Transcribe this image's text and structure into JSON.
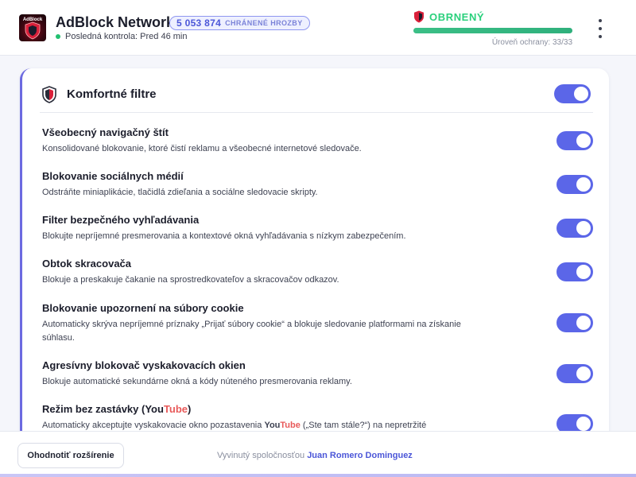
{
  "header": {
    "app_title": "AdBlock Network",
    "logo_text": "AdBlock",
    "threats_count": "5 053 874",
    "threats_label": "CHRÁNENÉ HROZBY",
    "last_check": "Posledná kontrola: Pred 46 min",
    "status": "OBRNENÝ",
    "protection_level_text": "Úroveň ochrany: 33/33",
    "protection_level_fraction": 1.0,
    "menu_icon": "kebab-menu-icon"
  },
  "card": {
    "title": "Komfortné filtre",
    "enabled": true,
    "items": [
      {
        "title": "Všeobecný navigačný štít",
        "desc": "Konsolidované blokovanie, ktoré čistí reklamu a všeobecné internetové sledovače.",
        "enabled": true
      },
      {
        "title": "Blokovanie sociálnych médií",
        "desc": "Odstráňte miniaplikácie, tlačidlá zdieľania a sociálne sledovacie skripty.",
        "enabled": true
      },
      {
        "title": "Filter bezpečného vyhľadávania",
        "desc": "Blokujte nepríjemné presmerovania a kontextové okná vyhľadávania s nízkym zabezpečením.",
        "enabled": true
      },
      {
        "title": "Obtok skracovača",
        "desc": "Blokuje a preskakuje čakanie na sprostredkovateľov a skracovačov odkazov.",
        "enabled": true
      },
      {
        "title": "Blokovanie upozornení na súbory cookie",
        "desc": "Automaticky skrýva nepríjemné príznaky „Prijať súbory cookie“ a blokuje sledovanie platformami na získanie súhlasu.",
        "enabled": true
      },
      {
        "title": "Agresívny blokovač vyskakovacích okien",
        "desc": "Blokuje automatické sekundárne okná a kódy núteného presmerovania reklamy.",
        "enabled": true
      },
      {
        "title_prefix": "Režim bez zastávky (",
        "title_you": "You",
        "title_tube": "Tube",
        "title_suffix": ")",
        "desc_prefix": "Automaticky akceptujte vyskakovacie okno pozastavenia ",
        "desc_brand_you": "You",
        "desc_brand_tube": "Tube",
        "desc_suffix": " („Ste tam stále?“) na nepretržité",
        "enabled": true
      }
    ]
  },
  "footer": {
    "rate_button": "Ohodnotiť rozšírenie",
    "credit_prefix": "Vyvinutý spoločnosťou",
    "author": "Juan Romero Dominguez"
  },
  "colors": {
    "accent": "#5b66e8",
    "status_green": "#2ad07c",
    "youtube_red": "#e85a5a"
  }
}
